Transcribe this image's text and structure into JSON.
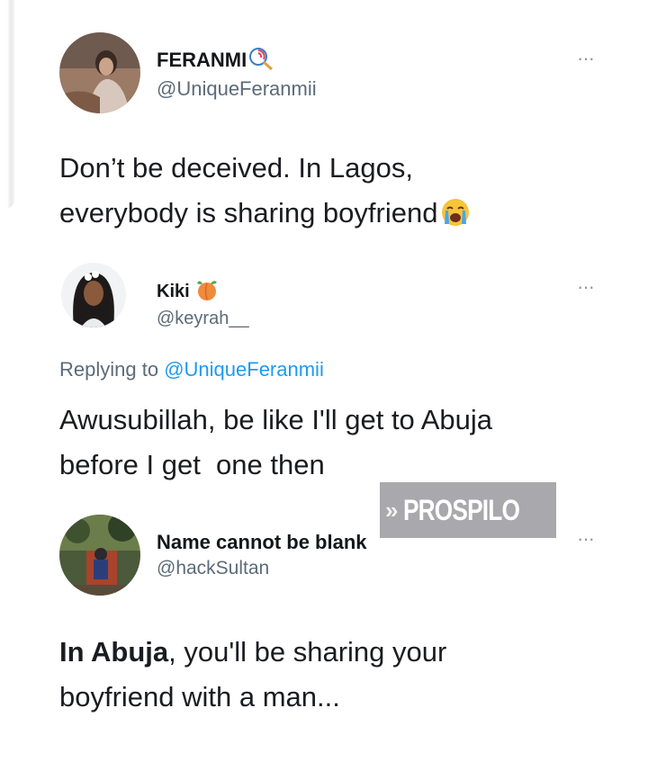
{
  "tweet1": {
    "name": "FERANMI",
    "name_emoji": "lollipop-icon",
    "handle": "@UniqueFeranmii",
    "more": "···",
    "text_line1": "Don’t be deceived. In Lagos,",
    "text_line2": "everybody is sharing boyfriend",
    "text_emoji": "crying-face-icon"
  },
  "tweet2": {
    "name": "Kiki",
    "name_emoji": "peach-icon",
    "handle": "@keyrah__",
    "more": "···",
    "replying_prefix": "Replying to",
    "replying_mention": "@UniqueFeranmii",
    "text_line1": "Awusubillah, be like I'll get to Abuja",
    "text_line2": "before I get  one then"
  },
  "tweet3": {
    "name": "Name cannot be blank",
    "handle": "@hackSultan",
    "more": "···",
    "text_bold": "In Abuja",
    "text_rest": ", you'll be sharing your",
    "text_line2": "boyfriend with a man..."
  },
  "watermark": {
    "arrows": "»",
    "text": "PROSPILO"
  },
  "colors": {
    "handle": "#5b6b78",
    "mention": "#1d9bf0",
    "more": "#8899a6",
    "watermark_bg": "#a9a9ad"
  }
}
